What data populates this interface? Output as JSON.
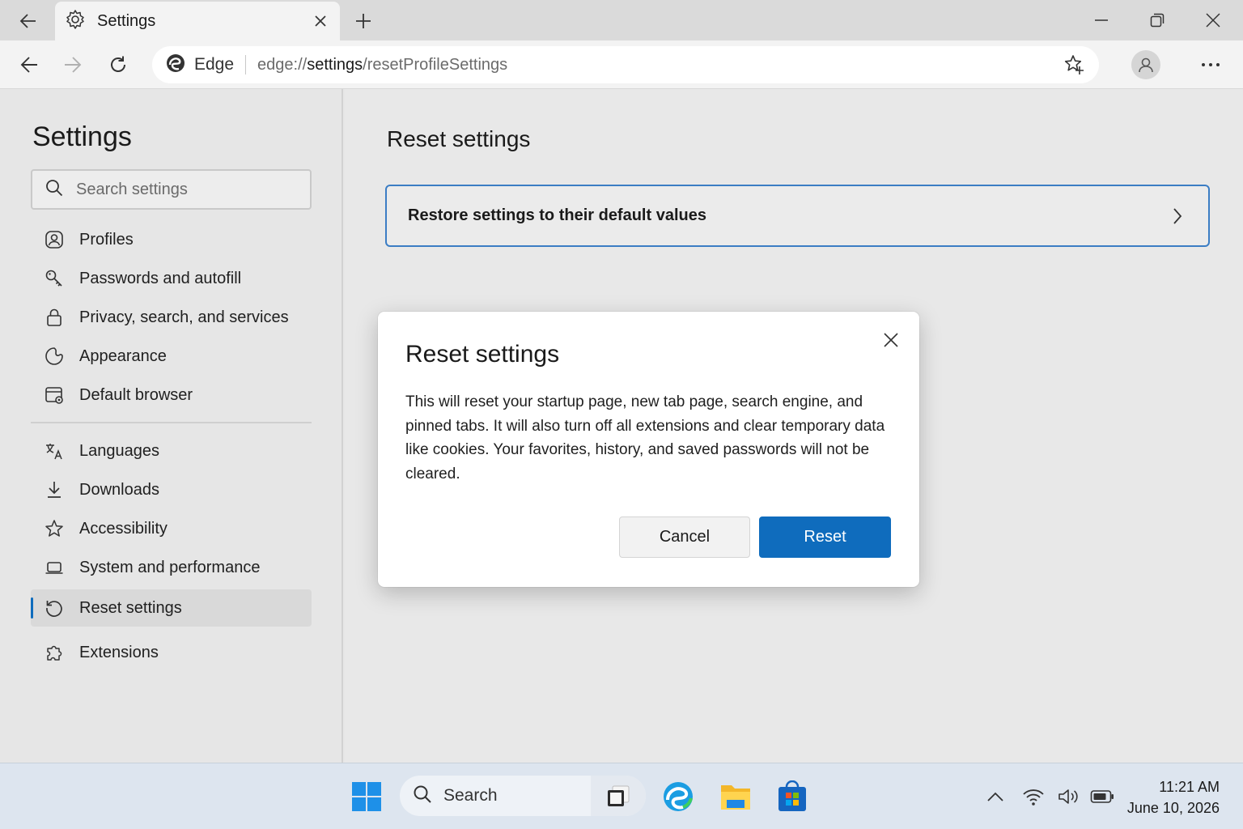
{
  "browser": {
    "tab_title": "Settings",
    "address": {
      "brand": "Edge",
      "url_prefix": "edge://",
      "url_host": "settings",
      "url_path": "/resetProfileSettings"
    }
  },
  "sidebar": {
    "title": "Settings",
    "search_placeholder": "Search settings",
    "items": [
      {
        "label": "Profiles",
        "icon": "profile-icon"
      },
      {
        "label": "Passwords and autofill",
        "icon": "key-icon"
      },
      {
        "label": "Privacy, search, and services",
        "icon": "lock-icon"
      },
      {
        "label": "Appearance",
        "icon": "appearance-icon"
      },
      {
        "label": "Default browser",
        "icon": "default-browser-icon"
      },
      {
        "label": "Languages",
        "icon": "languages-icon"
      },
      {
        "label": "Downloads",
        "icon": "download-icon"
      },
      {
        "label": "Accessibility",
        "icon": "accessibility-icon"
      },
      {
        "label": "System and performance",
        "icon": "laptop-icon"
      },
      {
        "label": "Reset settings",
        "icon": "reset-icon",
        "active": true
      },
      {
        "label": "Extensions",
        "icon": "puzzle-icon"
      }
    ]
  },
  "main": {
    "title": "Reset settings",
    "restore_card_label": "Restore settings to their default values"
  },
  "dialog": {
    "title": "Reset settings",
    "body": "This will reset your startup page, new tab page, search engine, and pinned tabs. It will also turn off all extensions and clear temporary data like cookies. Your favorites, history, and saved passwords will not be cleared.",
    "cancel_label": "Cancel",
    "reset_label": "Reset"
  },
  "taskbar": {
    "search_label": "Search",
    "time": "11:21 AM",
    "date": "June 10, 2026"
  },
  "colors": {
    "accent": "#0f6cbd",
    "card_border": "#3b7dc4"
  }
}
